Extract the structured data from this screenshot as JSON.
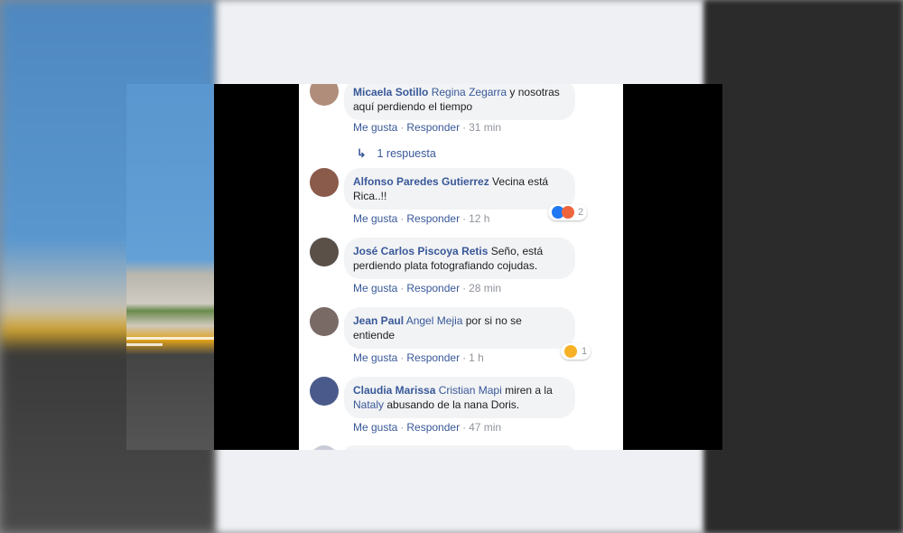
{
  "comments": [
    {
      "author": "Micaela Sotillo",
      "tag": "Regina Zegarra",
      "text": " y nosotras aquí perdiendo el tiempo",
      "like": "Me gusta",
      "respond": "Responder",
      "time": "31 min",
      "replies": "1 respuesta"
    },
    {
      "author": "Alfonso Paredes Gutierrez",
      "text": " Vecina está Rica..!!",
      "like": "Me gusta",
      "respond": "Responder",
      "time": "12 h",
      "reactions": "2"
    },
    {
      "author": "José Carlos Piscoya Retis",
      "text": " Seño, está perdiendo plata fotografiando cojudas.",
      "like": "Me gusta",
      "respond": "Responder",
      "time": "28 min"
    },
    {
      "author": "Jean Paul",
      "tag": "Angel Mejia",
      "text": " por si no se entiende",
      "like": "Me gusta",
      "respond": "Responder",
      "time": "1 h",
      "reactions": "1"
    },
    {
      "author": "Claudia Marissa",
      "tag": "Cristian Mapi",
      "text_pre": " miren a la ",
      "tag2": "Nataly",
      "text": " abusando de la nana Doris.",
      "like": "Me gusta",
      "respond": "Responder",
      "time": "47 min"
    }
  ],
  "separator": "·",
  "colors": {
    "link": "#385898",
    "muted": "#90949c",
    "bubble": "#f2f3f5"
  }
}
